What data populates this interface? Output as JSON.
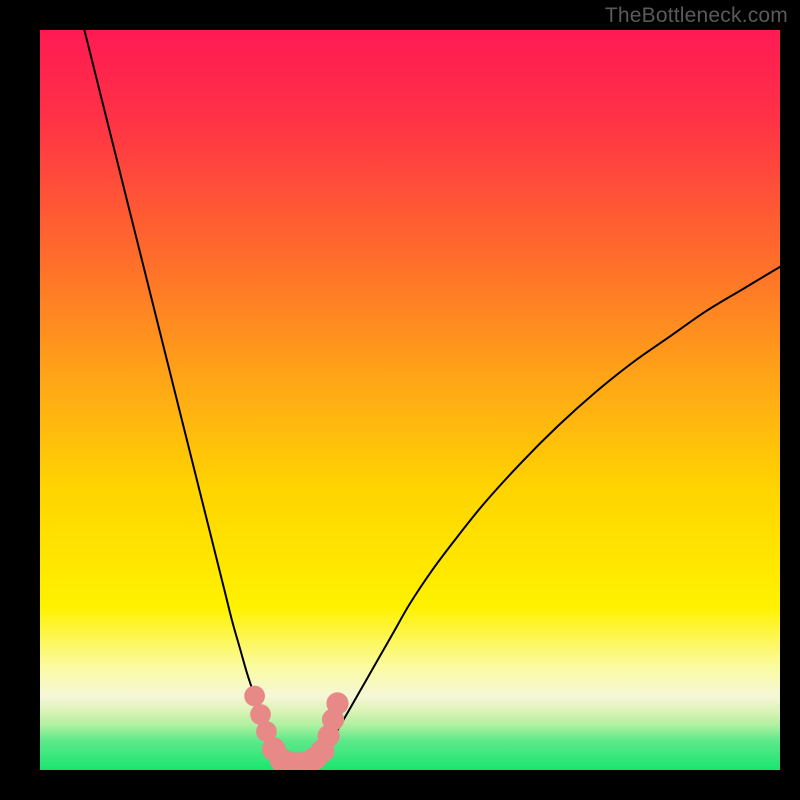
{
  "watermark": "TheBottleneck.com",
  "colors": {
    "curve_stroke": "#000000",
    "marker_fill": "#e78a87",
    "marker_stroke": "#e78a87",
    "gradient_top": "#ff1a53",
    "gradient_bottom": "#19e56f"
  },
  "chart_data": {
    "type": "line",
    "title": "",
    "xlabel": "",
    "ylabel": "",
    "xlim": [
      0,
      100
    ],
    "ylim": [
      0,
      100
    ],
    "series": [
      {
        "name": "left-branch",
        "x": [
          6,
          8,
          10,
          12,
          14,
          16,
          18,
          20,
          22,
          24,
          25,
          26,
          27,
          28,
          29,
          30,
          31,
          31.8
        ],
        "y": [
          100,
          92,
          84,
          76,
          68,
          60,
          52,
          44,
          36,
          28,
          24,
          20,
          16.5,
          13,
          10,
          7,
          4,
          1.5
        ]
      },
      {
        "name": "right-branch",
        "x": [
          38,
          39,
          40,
          42,
          44,
          46,
          48,
          50,
          53,
          56,
          60,
          65,
          70,
          75,
          80,
          85,
          90,
          95,
          100
        ],
        "y": [
          1.5,
          3,
          5,
          8.5,
          12,
          15.5,
          19,
          22.5,
          27,
          31,
          36,
          41.5,
          46.5,
          51,
          55,
          58.5,
          62,
          65,
          68
        ]
      },
      {
        "name": "valley-floor",
        "x": [
          31.8,
          33,
          34,
          35,
          36,
          37,
          38
        ],
        "y": [
          1.5,
          0.8,
          0.5,
          0.5,
          0.6,
          0.9,
          1.5
        ]
      }
    ],
    "markers": {
      "name": "valley-markers",
      "points": [
        {
          "x": 29.0,
          "y": 10.0,
          "r": 1.4
        },
        {
          "x": 29.8,
          "y": 7.5,
          "r": 1.4
        },
        {
          "x": 30.6,
          "y": 5.2,
          "r": 1.4
        },
        {
          "x": 31.6,
          "y": 2.8,
          "r": 1.6
        },
        {
          "x": 32.6,
          "y": 1.4,
          "r": 1.6
        },
        {
          "x": 33.8,
          "y": 0.9,
          "r": 1.6
        },
        {
          "x": 35.0,
          "y": 0.8,
          "r": 1.6
        },
        {
          "x": 36.2,
          "y": 1.0,
          "r": 1.6
        },
        {
          "x": 37.2,
          "y": 1.6,
          "r": 1.6
        },
        {
          "x": 38.2,
          "y": 2.6,
          "r": 1.6
        },
        {
          "x": 39.0,
          "y": 4.6,
          "r": 1.5
        },
        {
          "x": 39.6,
          "y": 6.8,
          "r": 1.5
        },
        {
          "x": 40.2,
          "y": 9.0,
          "r": 1.5
        }
      ]
    }
  }
}
